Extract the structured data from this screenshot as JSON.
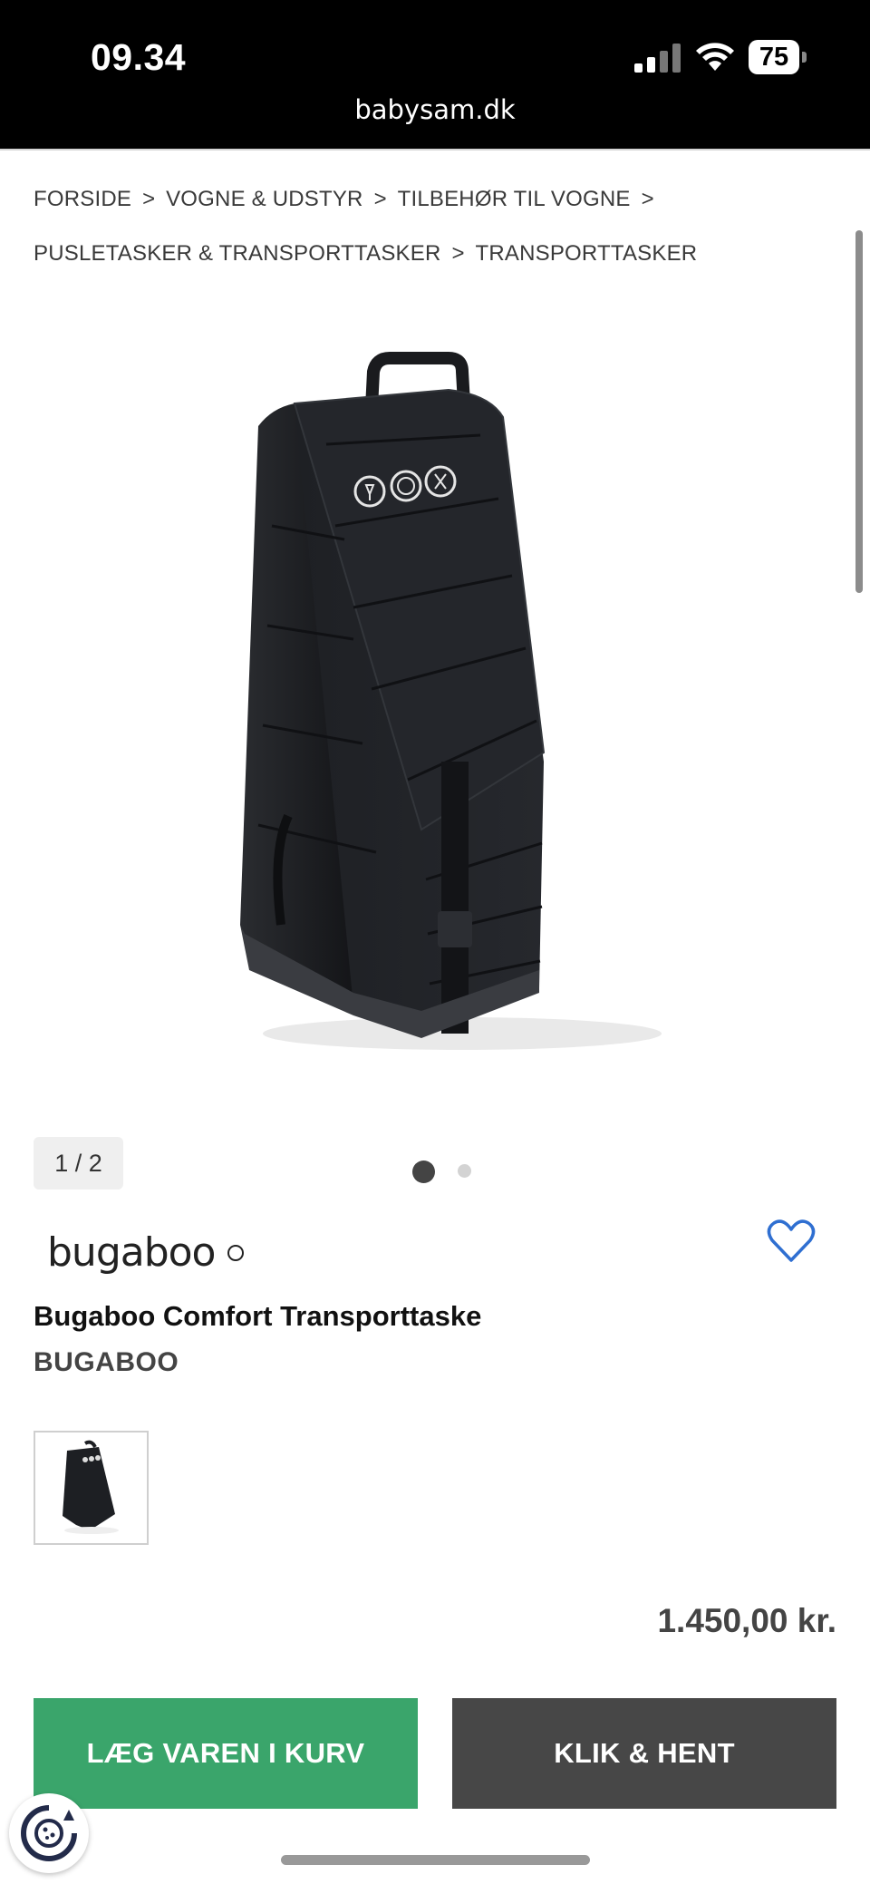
{
  "status_bar": {
    "time": "09.34",
    "url": "babysam.dk",
    "battery": "75"
  },
  "breadcrumb": {
    "items": [
      "FORSIDE",
      "VOGNE & UDSTYR",
      "TILBEHØR TIL VOGNE",
      "PUSLETASKER & TRANSPORTTASKER",
      "TRANSPORTTASKER"
    ],
    "separator": ">"
  },
  "gallery": {
    "counter": "1 / 2",
    "active_slide": 1,
    "total_slides": 2
  },
  "product": {
    "logo_text": "bugaboo",
    "title": "Bugaboo Comfort Transporttaske",
    "brand": "BUGABOO",
    "price": "1.450,00 kr."
  },
  "actions": {
    "add_to_cart": "LÆG VAREN I KURV",
    "click_collect": "KLIK & HENT"
  },
  "colors": {
    "cart_button": "#3aa56b",
    "pickup_button": "#474747",
    "heart": "#2f6fd1"
  }
}
